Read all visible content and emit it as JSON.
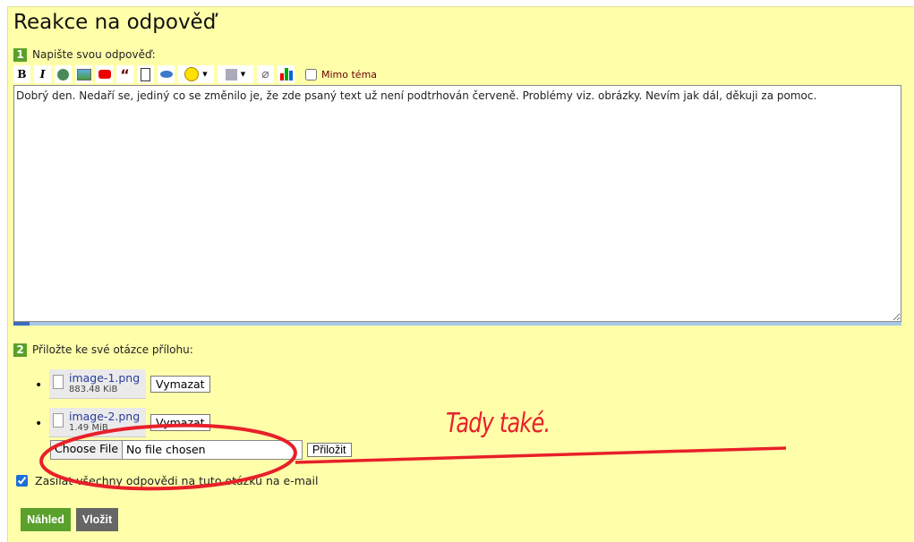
{
  "title": "Reakce na odpověď",
  "step1": {
    "num": "1",
    "label": "Napište svou odpověď:"
  },
  "toolbar": {
    "items": [
      "bold",
      "italic",
      "link",
      "image",
      "youtube",
      "quote",
      "code",
      "spoiler",
      "smiley",
      "dice",
      "attachment",
      "chart"
    ],
    "bold": "B",
    "italic": "I",
    "offtopic": "Mimo téma"
  },
  "reply_text": "Dobrý den. Nedaří se, jediný co se změnilo je, že zde psaný text už není podtrhován červeně. Problémy viz. obrázky. Nevím jak dál, děkuji za pomoc.",
  "step2": {
    "num": "2",
    "label": "Přiložte ke své otázce přílohu:"
  },
  "attachments": [
    {
      "name": "image-1.png",
      "size": "883.48 KiB",
      "button": "Vymazat"
    },
    {
      "name": "image-2.png",
      "size": "1.49 MiB",
      "button": "Vymazat"
    }
  ],
  "file_input": {
    "button": "Choose File",
    "status": "No file chosen",
    "attach": "Přiložit"
  },
  "email_label": "Zasílat všechny odpovědi na tuto otázku na e-mail",
  "email_checked": true,
  "buttons": {
    "preview": "Náhled",
    "submit": "Vložit"
  },
  "annotation": {
    "text": "Tady také.",
    "color": "#e8202a"
  },
  "colors": {
    "background": "#ffffaa",
    "green": "#5aa02c",
    "gray": "#666666"
  }
}
